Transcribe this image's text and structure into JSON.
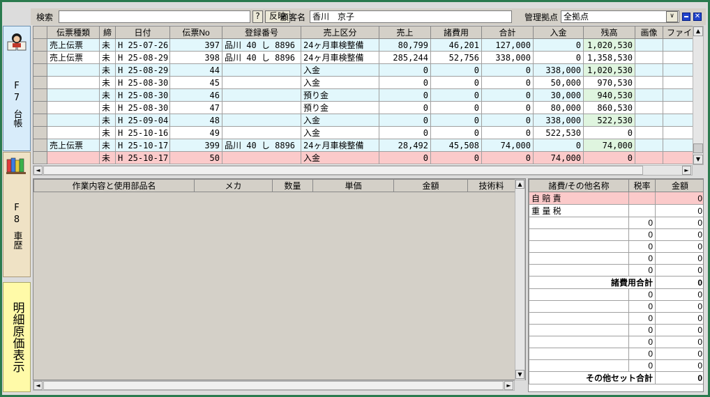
{
  "colors": {
    "accent": "#2a7a4e",
    "row_blue": "#e2f7fc",
    "row_pink": "#fbcaca",
    "balance_green": "#dff5df"
  },
  "sidebar": {
    "tab_f7_key": "F\n7",
    "tab_f7_label": "台帳",
    "tab_f8_key": "F\n8",
    "tab_f8_label": "車歴",
    "tab_detail_label": "明細原価表示",
    "icons": [
      "person-book-icon",
      "colorful-books-icon"
    ]
  },
  "topbar": {
    "search_label": "検索",
    "search_value": "",
    "help_label": "?",
    "apply_label": "反映",
    "customer_label": "顧客名",
    "customer_value": "香川　京子",
    "branch_label": "管理拠点",
    "branch_value": "全拠点"
  },
  "ledger": {
    "columns": [
      "伝票種類",
      "締",
      "日付",
      "伝票No",
      "登録番号",
      "売上区分",
      "売上",
      "諸費用",
      "合計",
      "入金",
      "残高",
      "画像",
      "ファイル"
    ],
    "rows": [
      {
        "style": "blue",
        "kind": "売上伝票",
        "close": "未",
        "date": "H 25-07-26",
        "no": "397",
        "reg": "品川 40 し 8896",
        "category": "24ヶ月車検整備",
        "sales": "80,799",
        "fees": "46,201",
        "total": "127,000",
        "payment": "0",
        "balance": "1,020,530",
        "image": "",
        "file": ""
      },
      {
        "style": "white",
        "kind": "売上伝票",
        "close": "未",
        "date": "H 25-08-29",
        "no": "398",
        "reg": "品川 40 し 8896",
        "category": "24ヶ月車検整備",
        "sales": "285,244",
        "fees": "52,756",
        "total": "338,000",
        "payment": "0",
        "balance": "1,358,530",
        "image": "",
        "file": ""
      },
      {
        "style": "blue",
        "kind": "",
        "close": "未",
        "date": "H 25-08-29",
        "no": "44",
        "reg": "",
        "category": "入金",
        "sales": "0",
        "fees": "0",
        "total": "0",
        "payment": "338,000",
        "balance": "1,020,530",
        "image": "",
        "file": ""
      },
      {
        "style": "white",
        "kind": "",
        "close": "未",
        "date": "H 25-08-30",
        "no": "45",
        "reg": "",
        "category": "入金",
        "sales": "0",
        "fees": "0",
        "total": "0",
        "payment": "50,000",
        "balance": "970,530",
        "image": "",
        "file": ""
      },
      {
        "style": "blue",
        "kind": "",
        "close": "未",
        "date": "H 25-08-30",
        "no": "46",
        "reg": "",
        "category": "預り金",
        "sales": "0",
        "fees": "0",
        "total": "0",
        "payment": "30,000",
        "balance": "940,530",
        "image": "",
        "file": ""
      },
      {
        "style": "white",
        "kind": "",
        "close": "未",
        "date": "H 25-08-30",
        "no": "47",
        "reg": "",
        "category": "預り金",
        "sales": "0",
        "fees": "0",
        "total": "0",
        "payment": "80,000",
        "balance": "860,530",
        "image": "",
        "file": ""
      },
      {
        "style": "blue",
        "kind": "",
        "close": "未",
        "date": "H 25-09-04",
        "no": "48",
        "reg": "",
        "category": "入金",
        "sales": "0",
        "fees": "0",
        "total": "0",
        "payment": "338,000",
        "balance": "522,530",
        "image": "",
        "file": ""
      },
      {
        "style": "white",
        "kind": "",
        "close": "未",
        "date": "H 25-10-16",
        "no": "49",
        "reg": "",
        "category": "入金",
        "sales": "0",
        "fees": "0",
        "total": "0",
        "payment": "522,530",
        "balance": "0",
        "image": "",
        "file": ""
      },
      {
        "style": "blue",
        "kind": "売上伝票",
        "close": "未",
        "date": "H 25-10-17",
        "no": "399",
        "reg": "品川 40 し 8896",
        "category": "24ヶ月車検整備",
        "sales": "28,492",
        "fees": "45,508",
        "total": "74,000",
        "payment": "0",
        "balance": "74,000",
        "image": "",
        "file": ""
      },
      {
        "style": "pink",
        "kind": "",
        "close": "未",
        "date": "H 25-10-17",
        "no": "50",
        "reg": "",
        "category": "入金",
        "sales": "0",
        "fees": "0",
        "total": "0",
        "payment": "74,000",
        "balance": "0",
        "image": "",
        "file": ""
      }
    ]
  },
  "work": {
    "columns": [
      "作業内容と使用部品名",
      "メカ",
      "数量",
      "単価",
      "金額",
      "技術料"
    ]
  },
  "fees": {
    "columns": [
      "諸費/その他名称",
      "税率",
      "金額"
    ],
    "rows": [
      {
        "name": "自 賠 責",
        "rate": "",
        "amount": "0",
        "style": "pink"
      },
      {
        "name": "重 量 税",
        "rate": "",
        "amount": "0",
        "style": "white"
      },
      {
        "name": "",
        "rate": "0",
        "amount": "0",
        "style": "white"
      },
      {
        "name": "",
        "rate": "0",
        "amount": "0",
        "style": "white"
      },
      {
        "name": "",
        "rate": "0",
        "amount": "0",
        "style": "white"
      },
      {
        "name": "",
        "rate": "0",
        "amount": "0",
        "style": "white"
      },
      {
        "name": "",
        "rate": "0",
        "amount": "0",
        "style": "white"
      },
      {
        "name": "諸費用合計",
        "rate": "",
        "amount": "0",
        "style": "total"
      },
      {
        "name": "",
        "rate": "0",
        "amount": "0",
        "style": "white"
      },
      {
        "name": "",
        "rate": "0",
        "amount": "0",
        "style": "white"
      },
      {
        "name": "",
        "rate": "0",
        "amount": "0",
        "style": "white"
      },
      {
        "name": "",
        "rate": "0",
        "amount": "0",
        "style": "white"
      },
      {
        "name": "",
        "rate": "0",
        "amount": "0",
        "style": "white"
      },
      {
        "name": "",
        "rate": "0",
        "amount": "0",
        "style": "white"
      },
      {
        "name": "",
        "rate": "0",
        "amount": "0",
        "style": "white"
      },
      {
        "name": "その他セット合計",
        "rate": "",
        "amount": "0",
        "style": "total"
      }
    ]
  }
}
